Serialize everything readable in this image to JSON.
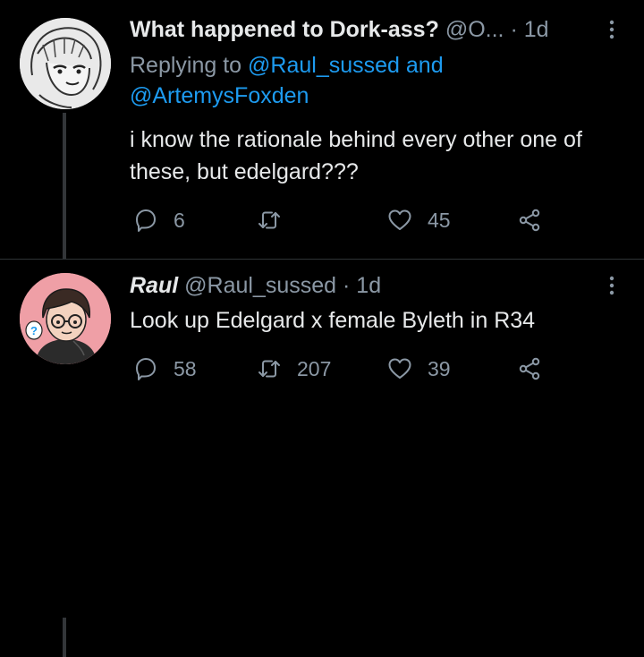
{
  "tweets": [
    {
      "display_name": "What happened to Dork-ass?",
      "handle": "@O...",
      "separator": "·",
      "time": "1d",
      "reply_prefix": "Replying to",
      "reply_mention_1": "@Raul_sussed",
      "reply_and": "and",
      "reply_mention_2": "@ArtemysFoxden",
      "text": "i know the rationale behind every other one of these, but edelgard???",
      "replies": "6",
      "retweets": "",
      "likes": "45",
      "avatar_icon": "avatar-sketch-portrait"
    },
    {
      "display_name": "Raul",
      "handle": "@Raul_sussed",
      "separator": "·",
      "time": "1d",
      "text": "Look up Edelgard x female Byleth in R34",
      "replies": "58",
      "retweets": "207",
      "likes": "39",
      "avatar_icon": "avatar-cartoon-glasses"
    }
  ],
  "icons": {
    "reply": "reply-icon",
    "retweet": "retweet-icon",
    "like": "heart-icon",
    "share": "share-icon",
    "more": "more-options-icon"
  },
  "colors": {
    "background": "#000000",
    "text": "#e7e9ea",
    "muted": "#8b98a5",
    "link": "#1d9bf0",
    "thread_line": "#333639",
    "avatar_2_bg": "#ef9fa6"
  }
}
